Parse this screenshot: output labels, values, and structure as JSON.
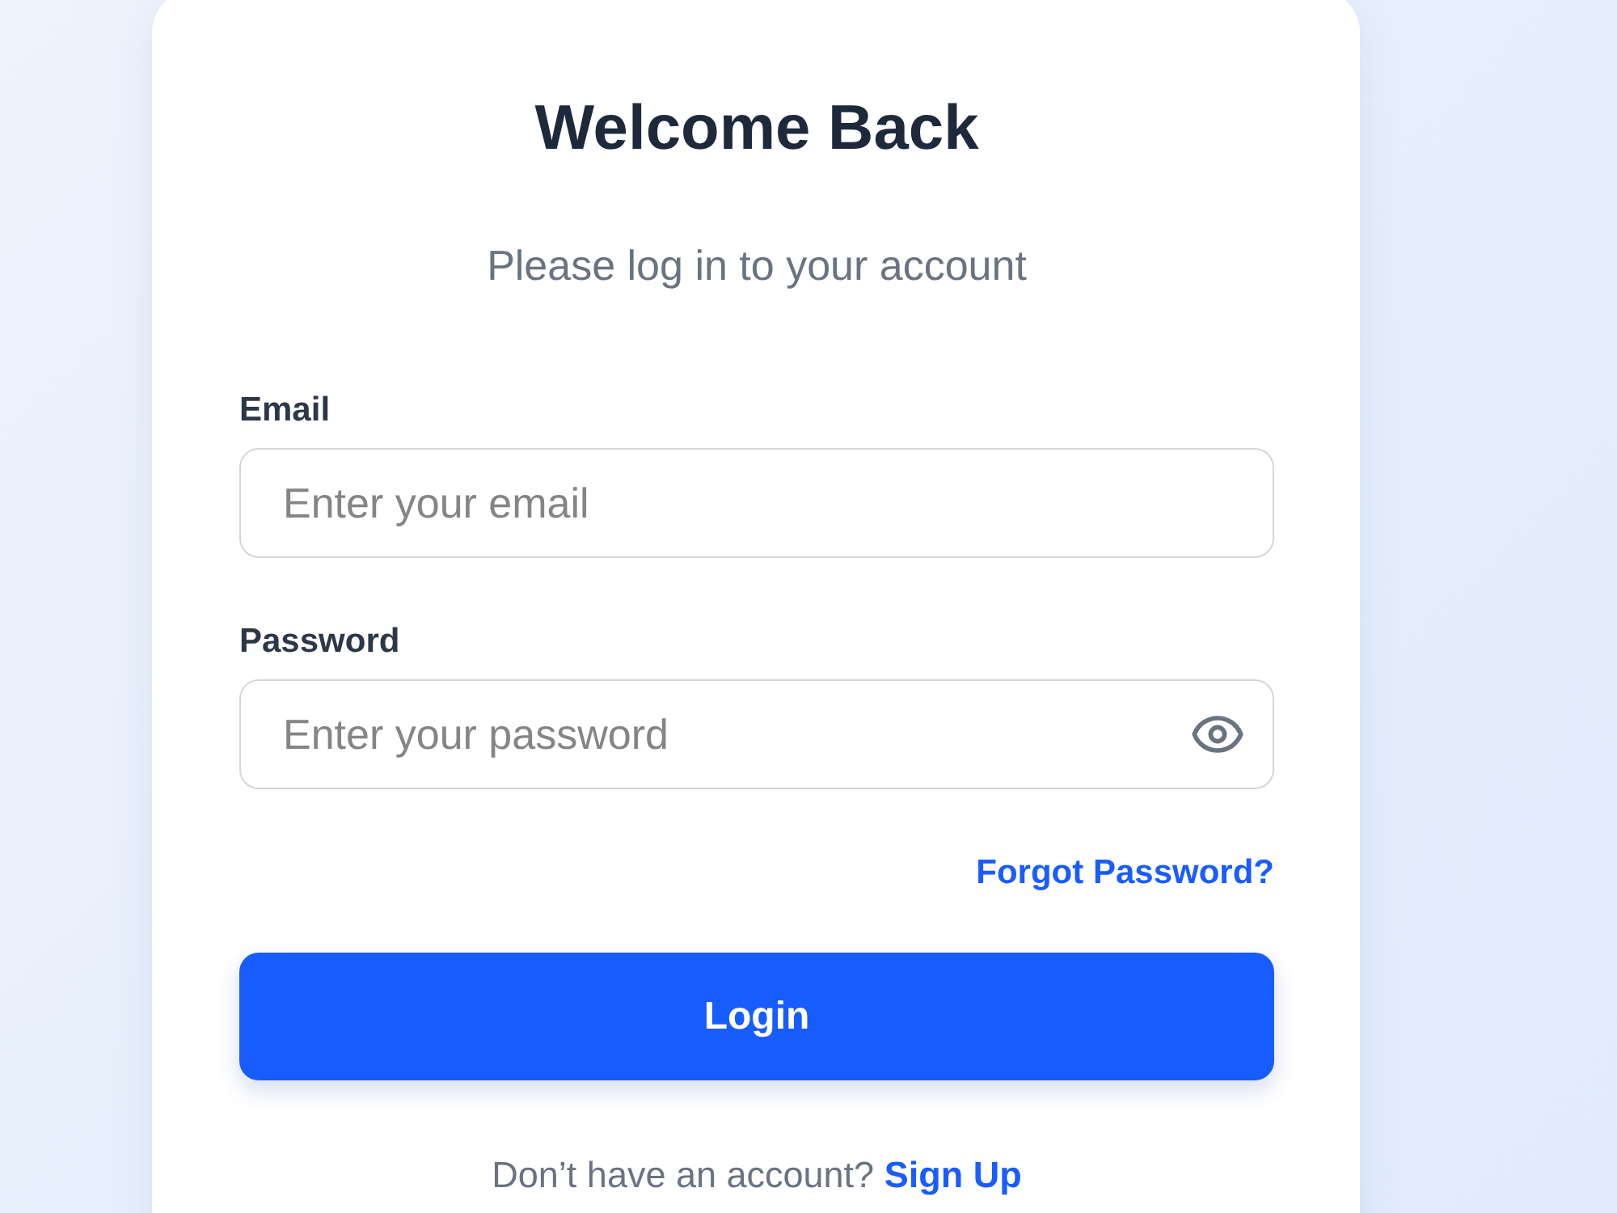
{
  "title": "Welcome Back",
  "subtitle": "Please log in to your account",
  "fields": [
    {
      "label": "Email",
      "placeholder": "Enter your email",
      "reveal_toggle": false
    },
    {
      "label": "Password",
      "placeholder": "Enter your password",
      "reveal_toggle": true
    }
  ],
  "forgot_link": "Forgot Password?",
  "login_button": "Login",
  "signup": {
    "prompt": "Don’t have an account?",
    "link": "Sign Up"
  }
}
